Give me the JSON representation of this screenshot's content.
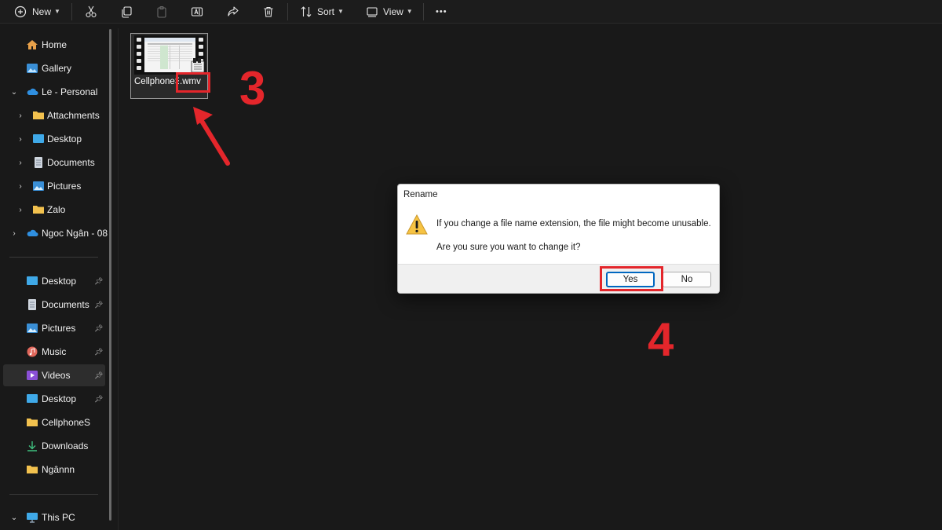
{
  "toolbar": {
    "new_label": "New",
    "sort_label": "Sort",
    "view_label": "View",
    "more_label": "•••"
  },
  "sidebar": {
    "quick": [
      {
        "label": "Home",
        "icon": "home-icon"
      },
      {
        "label": "Gallery",
        "icon": "gallery-icon"
      },
      {
        "label": "Le - Personal",
        "icon": "cloud-icon"
      },
      {
        "label": "Attachments",
        "icon": "folder-icon"
      },
      {
        "label": "Desktop",
        "icon": "desktop-icon"
      },
      {
        "label": "Documents",
        "icon": "documents-icon"
      },
      {
        "label": "Pictures",
        "icon": "pictures-icon"
      },
      {
        "label": "Zalo",
        "icon": "folder-icon"
      },
      {
        "label": "Ngoc Ngân - 08",
        "icon": "cloud-icon"
      }
    ],
    "pinned": [
      {
        "label": "Desktop",
        "icon": "desktop-icon",
        "pinned": true
      },
      {
        "label": "Documents",
        "icon": "documents-icon",
        "pinned": true
      },
      {
        "label": "Pictures",
        "icon": "pictures-icon",
        "pinned": true
      },
      {
        "label": "Music",
        "icon": "music-icon",
        "pinned": true
      },
      {
        "label": "Videos",
        "icon": "videos-icon",
        "pinned": true,
        "selected": true
      },
      {
        "label": "Desktop",
        "icon": "desktop-icon",
        "pinned": true
      },
      {
        "label": "CellphoneS",
        "icon": "folder-icon"
      },
      {
        "label": "Downloads",
        "icon": "downloads-icon"
      },
      {
        "label": "Ngânnn",
        "icon": "folder-icon"
      }
    ],
    "this_pc": "This PC"
  },
  "file": {
    "name_prefix": "CellphoneS",
    "name_ext": ".wmv"
  },
  "annotations": {
    "step3": "3",
    "step4": "4",
    "highlight_color": "#e4262b"
  },
  "dialog": {
    "title": "Rename",
    "message": "If you change a file name extension, the file might become unusable.",
    "question": "Are you sure you want to change it?",
    "yes_label": "Yes",
    "no_label": "No"
  }
}
